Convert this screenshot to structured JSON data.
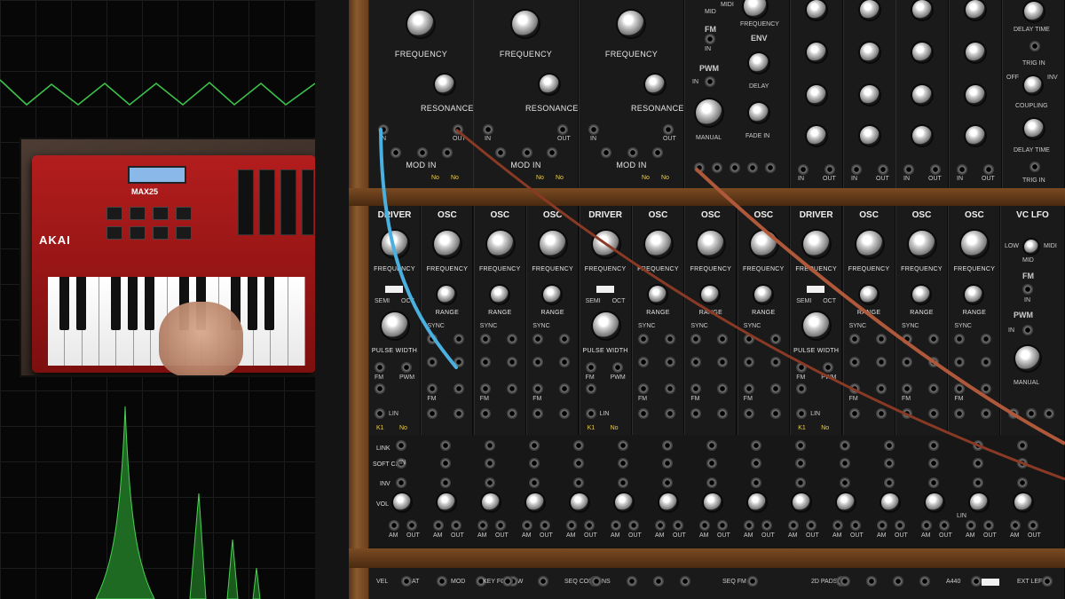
{
  "keyboard": {
    "brand": "AKAI",
    "model": "MAX25"
  },
  "top_row": {
    "filters": [
      {
        "knob1": "FREQUENCY",
        "knob2": "RESONANCE",
        "in": "IN",
        "out": "OUT",
        "mod": "MOD IN",
        "tag1": "No",
        "tag2": "No"
      },
      {
        "knob1": "FREQUENCY",
        "knob2": "RESONANCE",
        "in": "IN",
        "out": "OUT",
        "mod": "MOD IN",
        "tag1": "No",
        "tag2": "No"
      },
      {
        "knob1": "FREQUENCY",
        "knob2": "RESONANCE",
        "in": "IN",
        "out": "OUT",
        "mod": "MOD IN",
        "tag1": "No",
        "tag2": "No"
      }
    ],
    "lfo": {
      "mid": "MID",
      "midi": "MIDI",
      "freq": "FREQUENCY",
      "fm": "FM",
      "in": "IN",
      "pwm": "PWM",
      "in2": "IN",
      "manual": "MANUAL"
    },
    "env": {
      "title": "ENV",
      "delay": "DELAY",
      "fade": "FADE IN"
    },
    "delay": {
      "time": "DELAY TIME",
      "trig": "TRIG IN",
      "coupling": "COUPLING",
      "off": "OFF",
      "mode": "INV",
      "time2": "DELAY TIME",
      "trig2": "TRIG IN"
    },
    "bottom_jacks": [
      "IN",
      "OUT",
      "IN",
      "OUT",
      "IN",
      "OUT",
      "IN",
      "OUT"
    ]
  },
  "osc_row": {
    "modules": [
      {
        "title": "DRIVER",
        "knob1": "FREQUENCY",
        "semi": "SEMI",
        "oct": "OCT",
        "knob2": "PULSE WIDTH",
        "fm": "FM",
        "pwm": "PWM",
        "lin": "LIN",
        "tag1": "K1",
        "tag2": "No"
      },
      {
        "title": "OSC",
        "knob1": "FREQUENCY",
        "knob2": "RANGE",
        "sync": "SYNC",
        "fm": "FM"
      },
      {
        "title": "OSC",
        "knob1": "FREQUENCY",
        "knob2": "RANGE",
        "sync": "SYNC",
        "fm": "FM"
      },
      {
        "title": "OSC",
        "knob1": "FREQUENCY",
        "knob2": "RANGE",
        "sync": "SYNC",
        "fm": "FM"
      },
      {
        "title": "DRIVER",
        "knob1": "FREQUENCY",
        "semi": "SEMI",
        "oct": "OCT",
        "knob2": "PULSE WIDTH",
        "fm": "FM",
        "pwm": "PWM",
        "lin": "LIN",
        "tag1": "K1",
        "tag2": "No"
      },
      {
        "title": "OSC",
        "knob1": "FREQUENCY",
        "knob2": "RANGE",
        "sync": "SYNC",
        "fm": "FM"
      },
      {
        "title": "OSC",
        "knob1": "FREQUENCY",
        "knob2": "RANGE",
        "sync": "SYNC",
        "fm": "FM"
      },
      {
        "title": "OSC",
        "knob1": "FREQUENCY",
        "knob2": "RANGE",
        "sync": "SYNC",
        "fm": "FM"
      },
      {
        "title": "DRIVER",
        "knob1": "FREQUENCY",
        "semi": "SEMI",
        "oct": "OCT",
        "knob2": "PULSE WIDTH",
        "fm": "FM",
        "pwm": "PWM",
        "lin": "LIN",
        "tag1": "K1",
        "tag2": "No"
      },
      {
        "title": "OSC",
        "knob1": "FREQUENCY",
        "knob2": "RANGE",
        "sync": "SYNC",
        "fm": "FM"
      },
      {
        "title": "OSC",
        "knob1": "FREQUENCY",
        "knob2": "RANGE",
        "sync": "SYNC",
        "fm": "FM"
      },
      {
        "title": "OSC",
        "knob1": "FREQUENCY",
        "knob2": "RANGE",
        "sync": "SYNC",
        "fm": "FM"
      }
    ],
    "vclfo": {
      "title": "VC LFO",
      "low": "LOW",
      "midi": "MIDI",
      "mid": "MID",
      "fm": "FM",
      "in": "IN",
      "pwm": "PWM",
      "in2": "IN",
      "manual": "MANUAL"
    }
  },
  "mixer": {
    "row_labels": [
      "LINK",
      "SOFT CLIP",
      "INV",
      "VOL"
    ],
    "in_label": "IN",
    "am": "AM",
    "out": "OUT",
    "lin": "LIN"
  },
  "bottom_row": {
    "items": [
      "VEL",
      "AT",
      "MOD",
      "KEY FOLLOW",
      "SEQ COLUMNS",
      "SEQ FM IN",
      "2D PADS",
      "A440",
      "EXT LEFT"
    ]
  }
}
